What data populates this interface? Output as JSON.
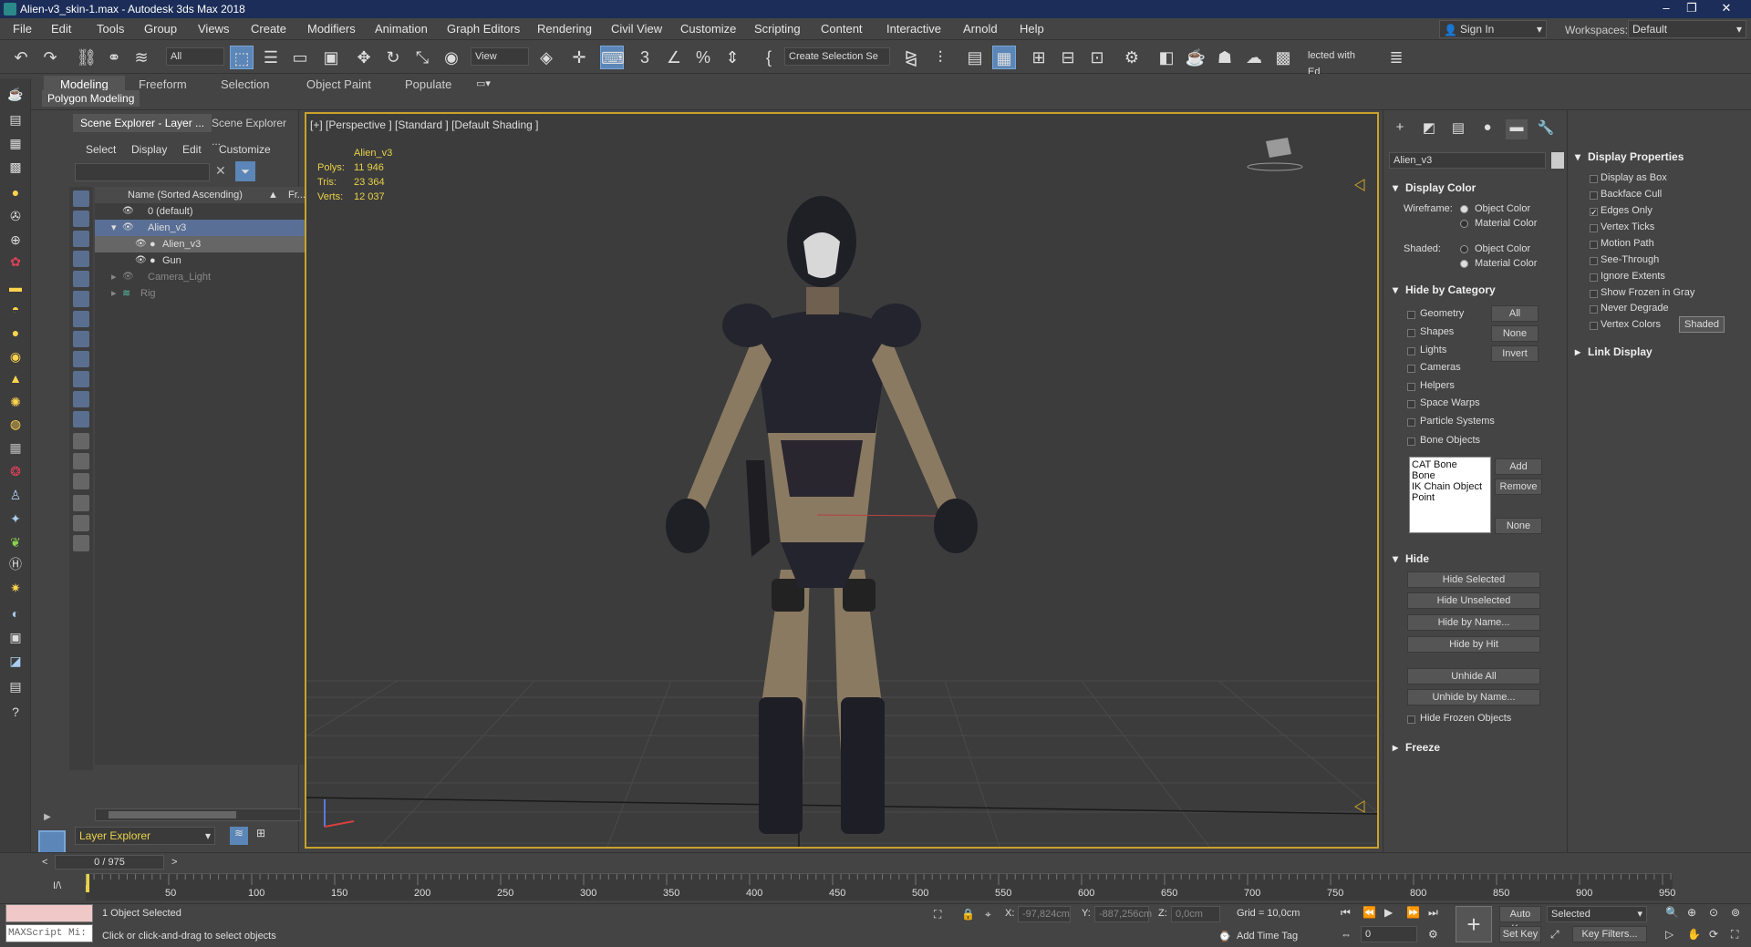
{
  "window": {
    "title": "Alien-v3_skin-1.max - Autodesk 3ds Max 2018"
  },
  "menu": [
    "File",
    "Edit",
    "Tools",
    "Group",
    "Views",
    "Create",
    "Modifiers",
    "Animation",
    "Graph Editors",
    "Rendering",
    "Civil View",
    "Customize",
    "Scripting",
    "Content",
    "Interactive",
    "Arnold",
    "Help"
  ],
  "account": {
    "signin": "Sign In",
    "workspaces_label": "Workspaces:",
    "workspace": "Default"
  },
  "toolbar": {
    "filter": "All",
    "refcoord": "View",
    "selection_set": "Create Selection Se",
    "named_sel": "lected with Ed"
  },
  "ribbon": {
    "tabs": [
      "Modeling",
      "Freeform",
      "Selection",
      "Object Paint",
      "Populate"
    ],
    "active": "Modeling",
    "subtab": "Polygon Modeling"
  },
  "scene_explorer": {
    "tabs": [
      "Scene Explorer - Layer ...",
      "Scene Explorer ..."
    ],
    "menu": [
      "Select",
      "Display",
      "Edit",
      "Customize"
    ],
    "col_name": "Name (Sorted Ascending)",
    "col_frozen": "Fr...",
    "rows": [
      {
        "label": "0 (default)"
      },
      {
        "label": "Alien_v3"
      },
      {
        "label": "Alien_v3"
      },
      {
        "label": "Gun"
      },
      {
        "label": "Camera_Light"
      },
      {
        "label": "Rig"
      }
    ],
    "explorer_select": "Layer Explorer"
  },
  "viewport": {
    "label": "[+] [Perspective ] [Standard ] [Default Shading ]",
    "object": "Alien_v3",
    "polys_label": "Polys:",
    "polys": "11 946",
    "tris_label": "Tris:",
    "tris": "23 364",
    "verts_label": "Verts:",
    "verts": "12 037"
  },
  "command_panel": {
    "object_name": "Alien_v3",
    "display_color": "Display Color",
    "wireframe_label": "Wireframe:",
    "shaded_label": "Shaded:",
    "object_color": "Object Color",
    "material_color": "Material Color",
    "hide_by_category": "Hide by Category",
    "categories": [
      "Geometry",
      "Shapes",
      "Lights",
      "Cameras",
      "Helpers",
      "Space Warps",
      "Particle Systems",
      "Bone Objects"
    ],
    "cat_buttons": [
      "All",
      "None",
      "Invert"
    ],
    "bone_list": [
      "CAT Bone",
      "Bone",
      "IK Chain Object",
      "Point"
    ],
    "list_buttons": [
      "Add",
      "Remove",
      "None"
    ],
    "hide": "Hide",
    "hide_buttons": [
      "Hide Selected",
      "Hide Unselected",
      "Hide by Name...",
      "Hide by Hit",
      "Unhide All",
      "Unhide by Name..."
    ],
    "hide_frozen": "Hide Frozen Objects",
    "freeze": "Freeze"
  },
  "display_properties": {
    "title": "Display Properties",
    "items": [
      {
        "label": "Display as Box",
        "checked": false
      },
      {
        "label": "Backface Cull",
        "checked": false
      },
      {
        "label": "Edges Only",
        "checked": true
      },
      {
        "label": "Vertex Ticks",
        "checked": false
      },
      {
        "label": "Motion Path",
        "checked": false
      },
      {
        "label": "See-Through",
        "checked": false
      },
      {
        "label": "Ignore Extents",
        "checked": false
      },
      {
        "label": "Show Frozen in Gray",
        "checked": false
      },
      {
        "label": "Never Degrade",
        "checked": false
      },
      {
        "label": "Vertex Colors",
        "checked": false
      }
    ],
    "shaded_btn": "Shaded",
    "link_display": "Link Display"
  },
  "timeline": {
    "frame": "0 / 975",
    "ticks": [
      "50",
      "100",
      "150",
      "200",
      "250",
      "300",
      "350",
      "400",
      "450",
      "500",
      "550",
      "600",
      "650",
      "700",
      "750",
      "800",
      "850",
      "900",
      "950"
    ]
  },
  "status": {
    "maxscript": "MAXScript Mi:",
    "selected": "1 Object Selected",
    "prompt": "Click or click-and-drag to select objects",
    "x_label": "X:",
    "x": "-97,824cm",
    "y_label": "Y:",
    "y": "-887,256cm",
    "z_label": "Z:",
    "z": "0,0cm",
    "grid": "Grid = 10,0cm",
    "add_time_tag": "Add Time Tag",
    "auto_key": "Auto Key",
    "set_key": "Set Key",
    "key_mode": "Selected",
    "key_filters": "Key Filters...",
    "frame_field": "0"
  },
  "colors": {
    "accent": "#5b86b7",
    "viewport_border": "#c9a22a",
    "stats": "#e8d24a",
    "titlebar": "#1b2d58"
  }
}
